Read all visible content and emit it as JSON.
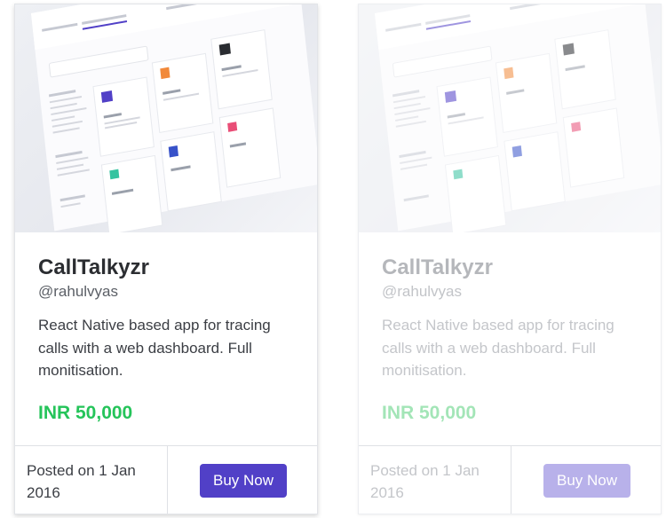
{
  "cards": [
    {
      "title": "CallTalkyzr",
      "handle": "@rahulvyas",
      "description": "React Native based app for tracing calls with a web dashboard. Full monitisation.",
      "price": "INR 50,000",
      "posted": "Posted on 1 Jan 2016",
      "buy_label": "Buy Now",
      "state": "active"
    },
    {
      "title": "CallTalkyzr",
      "handle": "@rahulvyas",
      "description": "React Native based app for tracing calls with a web dashboard. Full monitisation.",
      "price": "INR 50,000",
      "posted": "Posted on 1 Jan 2016",
      "buy_label": "Buy Now",
      "state": "faded"
    }
  ],
  "colors": {
    "accent": "#5140c7",
    "price_green": "#25c45a",
    "accent_faded": "#b8b1ea",
    "price_green_faded": "#a3e5b7"
  }
}
